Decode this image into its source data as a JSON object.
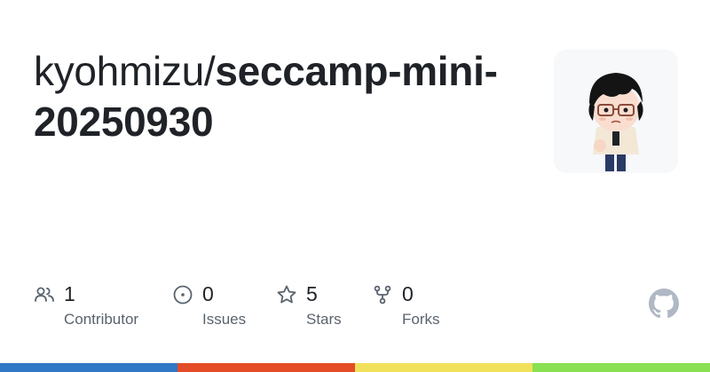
{
  "repo": {
    "owner": "kyohmizu/",
    "name_line1": "seccamp-mini-",
    "name_line2": "20250930"
  },
  "avatar": {
    "icon": "cartoon-avatar-icon"
  },
  "stats": [
    {
      "key": "contributors",
      "value": "1",
      "label": "Contributor",
      "icon": "people-icon"
    },
    {
      "key": "issues",
      "value": "0",
      "label": "Issues",
      "icon": "issue-opened-icon"
    },
    {
      "key": "stars",
      "value": "5",
      "label": "Stars",
      "icon": "star-icon"
    },
    {
      "key": "forks",
      "value": "0",
      "label": "Forks",
      "icon": "repo-forked-icon"
    }
  ],
  "brand": {
    "icon": "github-mark-icon"
  },
  "language_bar_colors": [
    "#3178c6",
    "#e34c26",
    "#f1e05a",
    "#89e051"
  ]
}
